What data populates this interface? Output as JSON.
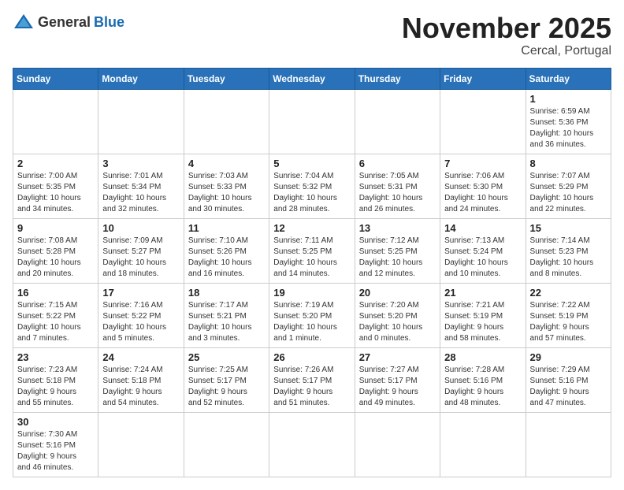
{
  "header": {
    "logo_general": "General",
    "logo_blue": "Blue",
    "month_title": "November 2025",
    "location": "Cercal, Portugal"
  },
  "days_of_week": [
    "Sunday",
    "Monday",
    "Tuesday",
    "Wednesday",
    "Thursday",
    "Friday",
    "Saturday"
  ],
  "weeks": [
    [
      {
        "num": "",
        "info": ""
      },
      {
        "num": "",
        "info": ""
      },
      {
        "num": "",
        "info": ""
      },
      {
        "num": "",
        "info": ""
      },
      {
        "num": "",
        "info": ""
      },
      {
        "num": "",
        "info": ""
      },
      {
        "num": "1",
        "info": "Sunrise: 6:59 AM\nSunset: 5:36 PM\nDaylight: 10 hours\nand 36 minutes."
      }
    ],
    [
      {
        "num": "2",
        "info": "Sunrise: 7:00 AM\nSunset: 5:35 PM\nDaylight: 10 hours\nand 34 minutes."
      },
      {
        "num": "3",
        "info": "Sunrise: 7:01 AM\nSunset: 5:34 PM\nDaylight: 10 hours\nand 32 minutes."
      },
      {
        "num": "4",
        "info": "Sunrise: 7:03 AM\nSunset: 5:33 PM\nDaylight: 10 hours\nand 30 minutes."
      },
      {
        "num": "5",
        "info": "Sunrise: 7:04 AM\nSunset: 5:32 PM\nDaylight: 10 hours\nand 28 minutes."
      },
      {
        "num": "6",
        "info": "Sunrise: 7:05 AM\nSunset: 5:31 PM\nDaylight: 10 hours\nand 26 minutes."
      },
      {
        "num": "7",
        "info": "Sunrise: 7:06 AM\nSunset: 5:30 PM\nDaylight: 10 hours\nand 24 minutes."
      },
      {
        "num": "8",
        "info": "Sunrise: 7:07 AM\nSunset: 5:29 PM\nDaylight: 10 hours\nand 22 minutes."
      }
    ],
    [
      {
        "num": "9",
        "info": "Sunrise: 7:08 AM\nSunset: 5:28 PM\nDaylight: 10 hours\nand 20 minutes."
      },
      {
        "num": "10",
        "info": "Sunrise: 7:09 AM\nSunset: 5:27 PM\nDaylight: 10 hours\nand 18 minutes."
      },
      {
        "num": "11",
        "info": "Sunrise: 7:10 AM\nSunset: 5:26 PM\nDaylight: 10 hours\nand 16 minutes."
      },
      {
        "num": "12",
        "info": "Sunrise: 7:11 AM\nSunset: 5:25 PM\nDaylight: 10 hours\nand 14 minutes."
      },
      {
        "num": "13",
        "info": "Sunrise: 7:12 AM\nSunset: 5:25 PM\nDaylight: 10 hours\nand 12 minutes."
      },
      {
        "num": "14",
        "info": "Sunrise: 7:13 AM\nSunset: 5:24 PM\nDaylight: 10 hours\nand 10 minutes."
      },
      {
        "num": "15",
        "info": "Sunrise: 7:14 AM\nSunset: 5:23 PM\nDaylight: 10 hours\nand 8 minutes."
      }
    ],
    [
      {
        "num": "16",
        "info": "Sunrise: 7:15 AM\nSunset: 5:22 PM\nDaylight: 10 hours\nand 7 minutes."
      },
      {
        "num": "17",
        "info": "Sunrise: 7:16 AM\nSunset: 5:22 PM\nDaylight: 10 hours\nand 5 minutes."
      },
      {
        "num": "18",
        "info": "Sunrise: 7:17 AM\nSunset: 5:21 PM\nDaylight: 10 hours\nand 3 minutes."
      },
      {
        "num": "19",
        "info": "Sunrise: 7:19 AM\nSunset: 5:20 PM\nDaylight: 10 hours\nand 1 minute."
      },
      {
        "num": "20",
        "info": "Sunrise: 7:20 AM\nSunset: 5:20 PM\nDaylight: 10 hours\nand 0 minutes."
      },
      {
        "num": "21",
        "info": "Sunrise: 7:21 AM\nSunset: 5:19 PM\nDaylight: 9 hours\nand 58 minutes."
      },
      {
        "num": "22",
        "info": "Sunrise: 7:22 AM\nSunset: 5:19 PM\nDaylight: 9 hours\nand 57 minutes."
      }
    ],
    [
      {
        "num": "23",
        "info": "Sunrise: 7:23 AM\nSunset: 5:18 PM\nDaylight: 9 hours\nand 55 minutes."
      },
      {
        "num": "24",
        "info": "Sunrise: 7:24 AM\nSunset: 5:18 PM\nDaylight: 9 hours\nand 54 minutes."
      },
      {
        "num": "25",
        "info": "Sunrise: 7:25 AM\nSunset: 5:17 PM\nDaylight: 9 hours\nand 52 minutes."
      },
      {
        "num": "26",
        "info": "Sunrise: 7:26 AM\nSunset: 5:17 PM\nDaylight: 9 hours\nand 51 minutes."
      },
      {
        "num": "27",
        "info": "Sunrise: 7:27 AM\nSunset: 5:17 PM\nDaylight: 9 hours\nand 49 minutes."
      },
      {
        "num": "28",
        "info": "Sunrise: 7:28 AM\nSunset: 5:16 PM\nDaylight: 9 hours\nand 48 minutes."
      },
      {
        "num": "29",
        "info": "Sunrise: 7:29 AM\nSunset: 5:16 PM\nDaylight: 9 hours\nand 47 minutes."
      }
    ],
    [
      {
        "num": "30",
        "info": "Sunrise: 7:30 AM\nSunset: 5:16 PM\nDaylight: 9 hours\nand 46 minutes."
      },
      {
        "num": "",
        "info": ""
      },
      {
        "num": "",
        "info": ""
      },
      {
        "num": "",
        "info": ""
      },
      {
        "num": "",
        "info": ""
      },
      {
        "num": "",
        "info": ""
      },
      {
        "num": "",
        "info": ""
      }
    ]
  ]
}
